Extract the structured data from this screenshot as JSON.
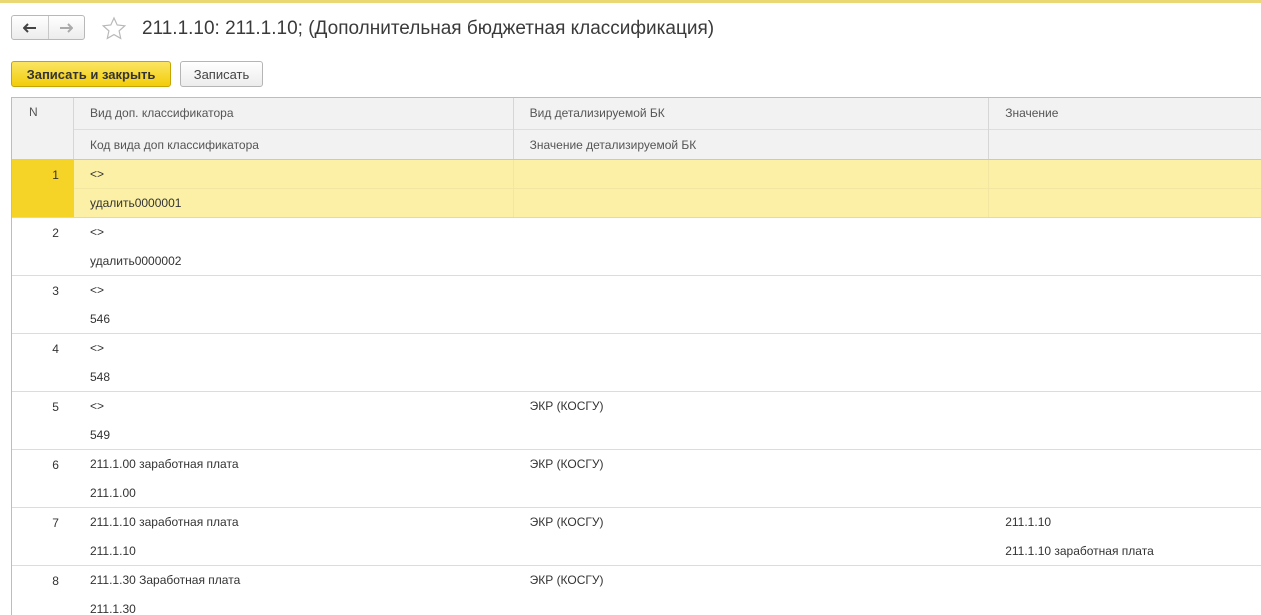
{
  "header": {
    "title": "211.1.10: 211.1.10; (Дополнительная бюджетная классификация)"
  },
  "toolbar": {
    "save_close_label": "Записать и закрыть",
    "save_label": "Записать"
  },
  "table": {
    "columns": {
      "n": "N",
      "col1_top": "Вид доп. классификатора",
      "col1_bottom": "Код вида доп классификатора",
      "col2_top": "Вид детализируемой БК",
      "col2_bottom": "Значение детализируемой БК",
      "col3_top": "Значение",
      "col3_bottom": ""
    },
    "rows": [
      {
        "n": "1",
        "c1a": "<>",
        "c1b": "удалить0000001",
        "c2a": "",
        "c2b": "",
        "c3a": "",
        "c3b": ""
      },
      {
        "n": "2",
        "c1a": "<>",
        "c1b": "удалить0000002",
        "c2a": "",
        "c2b": "",
        "c3a": "",
        "c3b": ""
      },
      {
        "n": "3",
        "c1a": "<>",
        "c1b": "546",
        "c2a": "",
        "c2b": "",
        "c3a": "",
        "c3b": ""
      },
      {
        "n": "4",
        "c1a": "<>",
        "c1b": "548",
        "c2a": "",
        "c2b": "",
        "c3a": "",
        "c3b": ""
      },
      {
        "n": "5",
        "c1a": "<>",
        "c1b": "549",
        "c2a": "ЭКР (КОСГУ)",
        "c2b": "",
        "c3a": "",
        "c3b": ""
      },
      {
        "n": "6",
        "c1a": "211.1.00 заработная плата",
        "c1b": "211.1.00",
        "c2a": "ЭКР (КОСГУ)",
        "c2b": "",
        "c3a": "",
        "c3b": ""
      },
      {
        "n": "7",
        "c1a": "211.1.10 заработная плата",
        "c1b": "211.1.10",
        "c2a": "ЭКР (КОСГУ)",
        "c2b": "",
        "c3a": "211.1.10",
        "c3b": "211.1.10 заработная плата"
      },
      {
        "n": "8",
        "c1a": "211.1.30 Заработная плата",
        "c1b": "211.1.30",
        "c2a": "ЭКР (КОСГУ)",
        "c2b": "",
        "c3a": "",
        "c3b": ""
      }
    ]
  },
  "icons": {
    "back": "arrow-left-icon",
    "forward": "arrow-right-icon",
    "favorite": "star-icon"
  },
  "colors": {
    "accent_yellow": "#f2cd09",
    "selected_row": "#fbf0a5",
    "selected_number": "#f5d327"
  }
}
